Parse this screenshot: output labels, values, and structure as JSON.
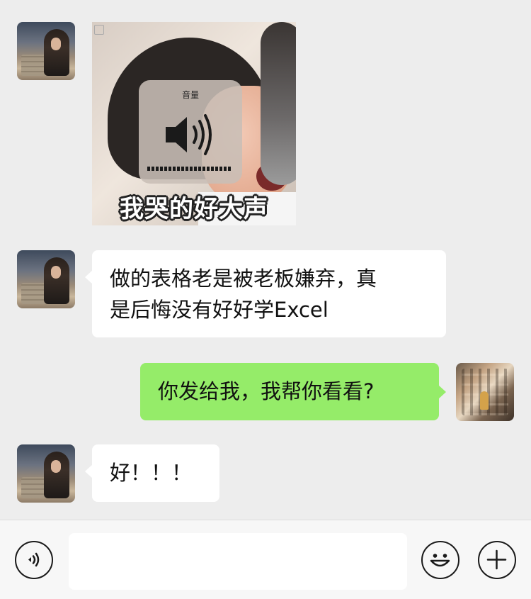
{
  "messages": [
    {
      "side": "left",
      "type": "sticker",
      "hud_label": "音量",
      "caption": "我哭的好大声"
    },
    {
      "side": "left",
      "type": "text",
      "lines": [
        "做的表格老是被老板嫌弃，真",
        "是后悔没有好好学Excel"
      ]
    },
    {
      "side": "right",
      "type": "text",
      "lines": [
        "你发给我，我帮你看看?"
      ]
    },
    {
      "side": "left",
      "type": "text",
      "lines": [
        "好！！！"
      ]
    }
  ],
  "input_bar": {
    "voice_icon": "voice-icon",
    "emoji_icon": "emoji-icon",
    "more_icon": "plus-icon",
    "input_value": ""
  },
  "colors": {
    "background": "#ededed",
    "incoming_bubble": "#ffffff",
    "outgoing_bubble": "#95ec69",
    "input_bar": "#f7f7f7"
  }
}
